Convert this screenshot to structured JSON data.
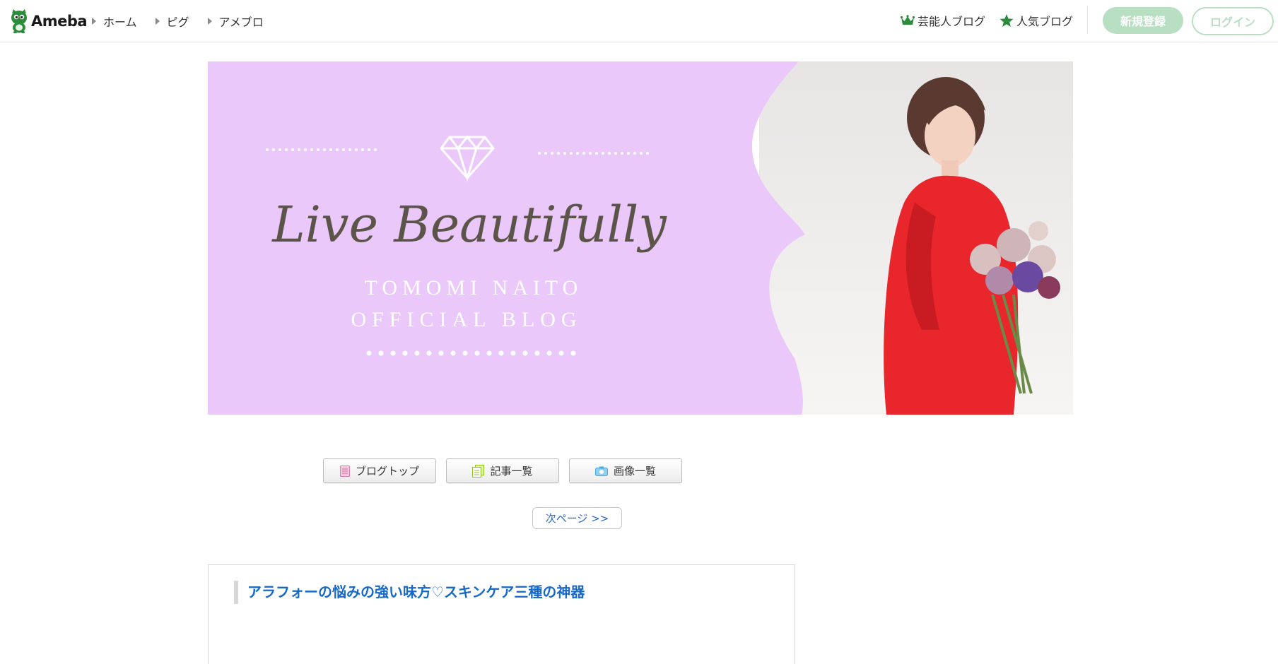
{
  "header": {
    "logo_text": "Ameba",
    "breadcrumbs": [
      "ホーム",
      "ピグ",
      "アメブロ"
    ],
    "links": [
      {
        "label": "芸能人ブログ",
        "icon": "crown-icon"
      },
      {
        "label": "人気ブログ",
        "icon": "star-icon"
      }
    ],
    "signup_label": "新規登録",
    "login_label": "ログイン",
    "accent_color": "#b9dfc3"
  },
  "banner": {
    "script_title": "Live Beautifully",
    "line1": "TOMOMI NAITO",
    "line2": "OFFICIAL BLOG",
    "bg_color": "#ebc8fa"
  },
  "nav": {
    "items": [
      {
        "label": "ブログトップ",
        "icon": "blog-top-icon"
      },
      {
        "label": "記事一覧",
        "icon": "article-list-icon"
      },
      {
        "label": "画像一覧",
        "icon": "camera-icon"
      }
    ],
    "next_page_label": "次ページ >>"
  },
  "article": {
    "title": "アラフォーの悩みの強い味方♡スキンケア三種の神器"
  }
}
